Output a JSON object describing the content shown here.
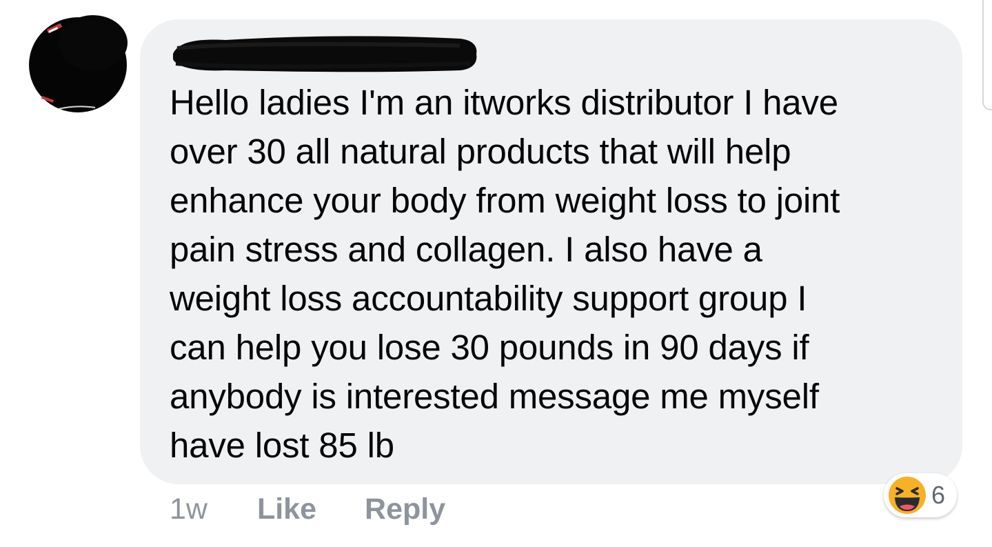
{
  "comment": {
    "author_redacted": true,
    "text_lines": [
      "Hello ladies I'm an itworks distributor I have",
      "over 30 all natural products that will help",
      "enhance your body from weight loss to joint",
      "pain stress and collagen.  I also have a",
      "weight loss accountability support group I",
      "can help you lose 30 pounds in 90 days if",
      "anybody is interested message me myself",
      "have lost 85 lb"
    ]
  },
  "actions": {
    "time": "1w",
    "like_label": "Like",
    "reply_label": "Reply"
  },
  "reactions": {
    "icon": "haha-emoji-icon",
    "count": "6"
  },
  "colors": {
    "bubble": "#f0f1f3",
    "text": "#050505",
    "meta": "#90949c",
    "haha_yellow": "#f7b125"
  }
}
